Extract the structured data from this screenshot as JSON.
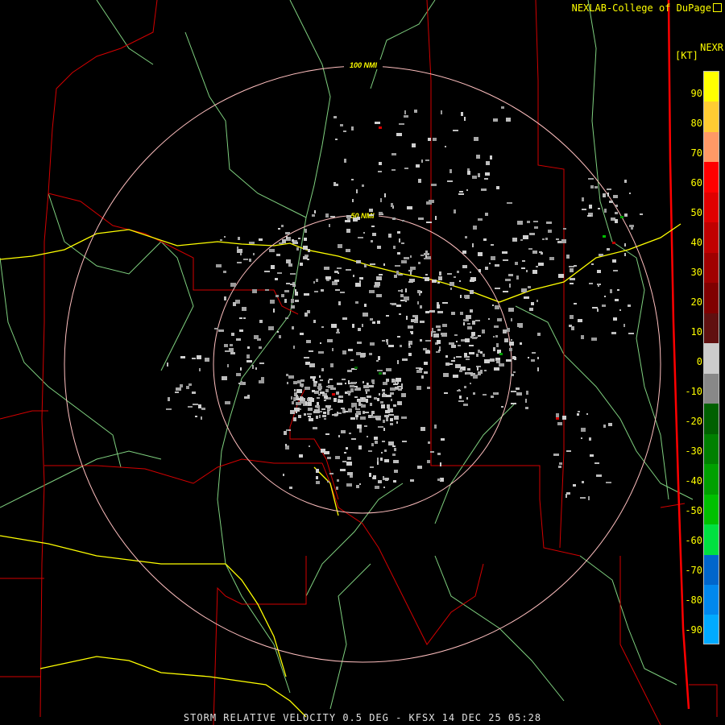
{
  "header": {
    "credit": "NEXLAB-College of DuPage",
    "product": "NEXR"
  },
  "legend": {
    "unit": "[KT]",
    "ticks": [
      "90",
      "80",
      "70",
      "60",
      "50",
      "40",
      "30",
      "20",
      "10",
      "0",
      "-10",
      "-20",
      "-30",
      "-40",
      "-50",
      "-60",
      "-70",
      "-80",
      "-90"
    ],
    "colors": [
      "#ffff00",
      "#ffcc33",
      "#ff9966",
      "#ff0000",
      "#e00000",
      "#c00000",
      "#a00000",
      "#800000",
      "#601010",
      "#cccccc",
      "#888888",
      "#006000",
      "#008000",
      "#00a000",
      "#00c000",
      "#00e040",
      "#0066cc",
      "#0088ee",
      "#00aaff"
    ]
  },
  "range_rings": {
    "outer_label": "100 NMI",
    "inner_label": "50 NMI"
  },
  "caption": "STORM RELATIVE VELOCITY 0.5 DEG - KFSX 14 DEC 25 05:28",
  "colors": {
    "background": "#000000",
    "county_lines": "#d40000",
    "highways": "#ffff00",
    "rivers": "#7fd07f",
    "rings": "#ffbfbf",
    "clutter": "#bdbdbd"
  }
}
